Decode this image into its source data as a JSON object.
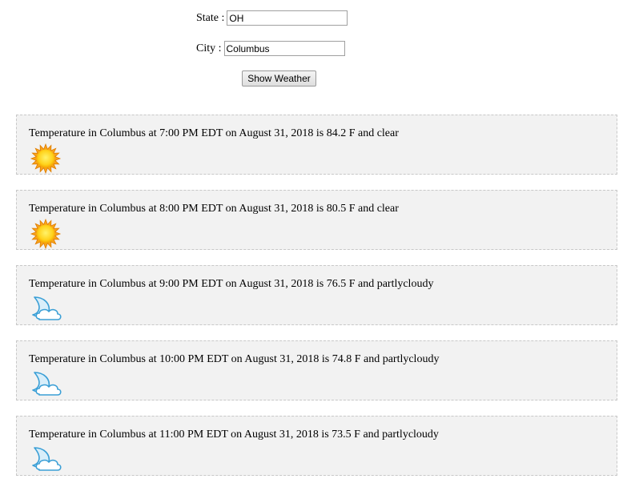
{
  "form": {
    "state_label": "State :",
    "state_value": "OH",
    "city_label": "City :",
    "city_value": "Columbus",
    "button_label": "Show Weather"
  },
  "forecasts": [
    {
      "text": "Temperature in Columbus at 7:00 PM EDT on August 31, 2018 is 84.2 F and clear",
      "icon": "sun-icon"
    },
    {
      "text": "Temperature in Columbus at 8:00 PM EDT on August 31, 2018 is 80.5 F and clear",
      "icon": "sun-icon"
    },
    {
      "text": "Temperature in Columbus at 9:00 PM EDT on August 31, 2018 is 76.5 F and partlycloudy",
      "icon": "moon-cloud-icon"
    },
    {
      "text": "Temperature in Columbus at 10:00 PM EDT on August 31, 2018 is 74.8 F and partlycloudy",
      "icon": "moon-cloud-icon"
    },
    {
      "text": "Temperature in Columbus at 11:00 PM EDT on August 31, 2018 is 73.5 F and partlycloudy",
      "icon": "moon-cloud-icon"
    }
  ]
}
